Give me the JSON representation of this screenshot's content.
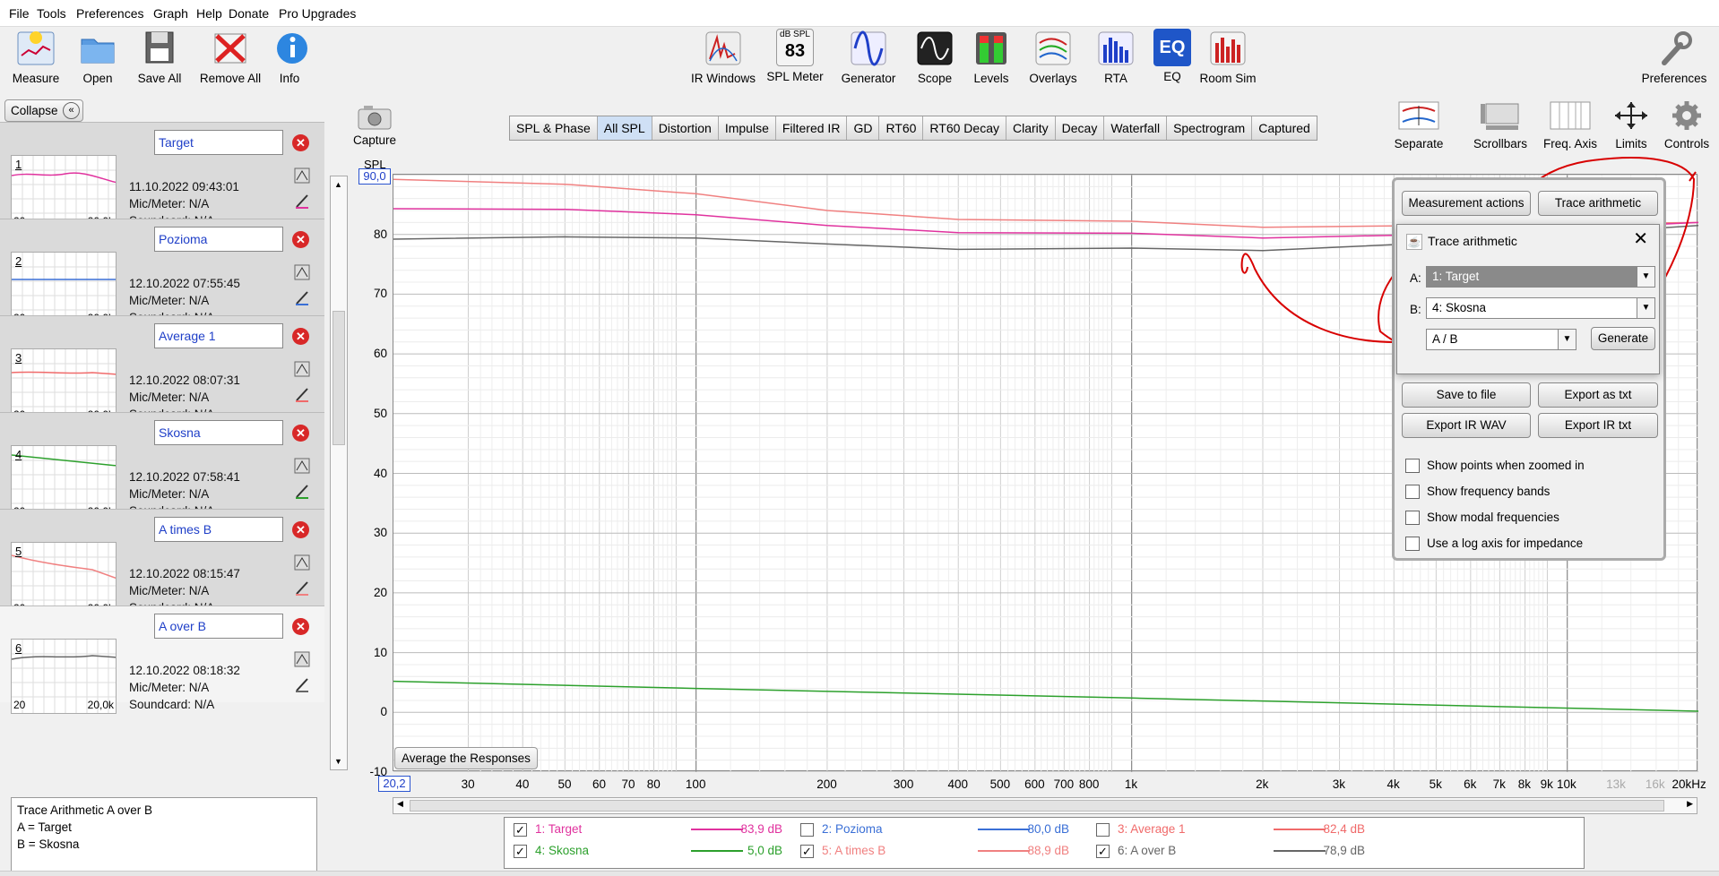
{
  "menu": [
    "File",
    "Tools",
    "Preferences",
    "Graph",
    "Help",
    "Donate",
    "Pro Upgrades"
  ],
  "toolbar_left": [
    {
      "label": "Measure",
      "icon": "measure-icon"
    },
    {
      "label": "Open",
      "icon": "folder-icon"
    },
    {
      "label": "Save All",
      "icon": "save-all-icon"
    },
    {
      "label": "Remove All",
      "icon": "remove-all-icon"
    },
    {
      "label": "Info",
      "icon": "info-icon"
    }
  ],
  "toolbar_center": [
    {
      "label": "IR Windows",
      "icon": "ir-windows-icon"
    },
    {
      "label": "SPL Meter",
      "icon": "spl-meter-icon",
      "caption": "dB SPL",
      "value": "83"
    },
    {
      "label": "Generator",
      "icon": "generator-icon"
    },
    {
      "label": "Scope",
      "icon": "scope-icon"
    },
    {
      "label": "Levels",
      "icon": "levels-icon"
    },
    {
      "label": "Overlays",
      "icon": "overlays-icon"
    },
    {
      "label": "RTA",
      "icon": "rta-icon"
    },
    {
      "label": "EQ",
      "icon": "eq-icon",
      "caption": "EQ"
    },
    {
      "label": "Room Sim",
      "icon": "room-sim-icon"
    }
  ],
  "preferences_label": "Preferences",
  "graph_tabs": [
    "SPL & Phase",
    "All SPL",
    "Distortion",
    "Impulse",
    "Filtered IR",
    "GD",
    "RT60",
    "RT60 Decay",
    "Clarity",
    "Decay",
    "Waterfall",
    "Spectrogram",
    "Captured"
  ],
  "active_tab": "All SPL",
  "graph_tools": [
    {
      "label": "Separate",
      "icon": "separate-icon"
    },
    {
      "label": "Scrollbars",
      "icon": "scrollbars-icon"
    },
    {
      "label": "Freq. Axis",
      "icon": "freq-axis-icon"
    },
    {
      "label": "Limits",
      "icon": "limits-icon"
    },
    {
      "label": "Controls",
      "icon": "gear-icon"
    }
  ],
  "capture_label": "Capture",
  "collapse_label": "Collapse",
  "measurements": [
    {
      "num": "1",
      "name": "Target",
      "date": "11.10.2022 09:43:01",
      "mic": "Mic/Meter: N/A",
      "sound": "Soundcard: N/A",
      "color": "#e0329e"
    },
    {
      "num": "2",
      "name": "Pozioma",
      "date": "12.10.2022 07:55:45",
      "mic": "Mic/Meter: N/A",
      "sound": "Soundcard: N/A",
      "color": "#3a6fd6"
    },
    {
      "num": "3",
      "name": "Average 1",
      "date": "12.10.2022 08:07:31",
      "mic": "Mic/Meter: N/A",
      "sound": "Soundcard: N/A",
      "color": "#f06a6a"
    },
    {
      "num": "4",
      "name": "Skosna",
      "date": "12.10.2022 07:58:41",
      "mic": "Mic/Meter: N/A",
      "sound": "Soundcard: N/A",
      "color": "#2ca02c"
    },
    {
      "num": "5",
      "name": "A times B",
      "date": "12.10.2022 08:15:47",
      "mic": "Mic/Meter: N/A",
      "sound": "Soundcard: N/A",
      "color": "#f08080"
    },
    {
      "num": "6",
      "name": "A over B",
      "date": "12.10.2022 08:18:32",
      "mic": "Mic/Meter: N/A",
      "sound": "Soundcard: N/A",
      "color": "#666666"
    }
  ],
  "thumb_min": "20",
  "thumb_max": "20,0k",
  "notes": [
    "Trace Arithmetic A over B",
    "A = Target",
    "B = Skosna"
  ],
  "graph": {
    "y_unit": "SPL",
    "y_top_value": "90,0",
    "y_ticks": [
      "80",
      "70",
      "60",
      "50",
      "40",
      "30",
      "20",
      "10",
      "0",
      "-10"
    ],
    "x_first": "20,2",
    "x_ticks": [
      "30",
      "40",
      "50",
      "60",
      "70",
      "80",
      "100",
      "200",
      "300",
      "400",
      "500",
      "600",
      "700",
      "800",
      "1k",
      "2k",
      "3k",
      "4k",
      "5k",
      "6k",
      "7k",
      "8k",
      "9k",
      "10k",
      "20kHz"
    ],
    "x_ticks_grey": [
      "13k",
      "16k"
    ],
    "avg_button": "Average the Responses"
  },
  "legend": [
    {
      "checked": true,
      "name": "1: Target",
      "value": "83,9 dB",
      "color": "#e0329e"
    },
    {
      "checked": false,
      "name": "2: Pozioma",
      "value": "80,0 dB",
      "color": "#3a6fd6"
    },
    {
      "checked": false,
      "name": "3: Average 1",
      "value": "82,4 dB",
      "color": "#f06a6a"
    },
    {
      "checked": true,
      "name": "4: Skosna",
      "value": "5,0 dB",
      "color": "#2ca02c"
    },
    {
      "checked": true,
      "name": "5: A times B",
      "value": "88,9 dB",
      "color": "#f08080"
    },
    {
      "checked": true,
      "name": "6: A over B",
      "value": "78,9 dB",
      "color": "#666666"
    }
  ],
  "panel": {
    "measurement_actions": "Measurement actions",
    "trace_arithmetic": "Trace arithmetic",
    "save_to_file": "Save to file",
    "export_as_txt": "Export as txt",
    "export_ir_wav": "Export IR WAV",
    "export_ir_txt": "Export IR txt",
    "checkboxes": [
      "Show points when zoomed in",
      "Show frequency bands",
      "Show modal frequencies",
      "Use a log axis for impedance"
    ]
  },
  "dialog": {
    "title": "Trace arithmetic",
    "a_label": "A:",
    "a_value": "1: Target",
    "b_label": "B:",
    "b_value": "4: Skosna",
    "op_value": "A / B",
    "generate": "Generate"
  }
}
